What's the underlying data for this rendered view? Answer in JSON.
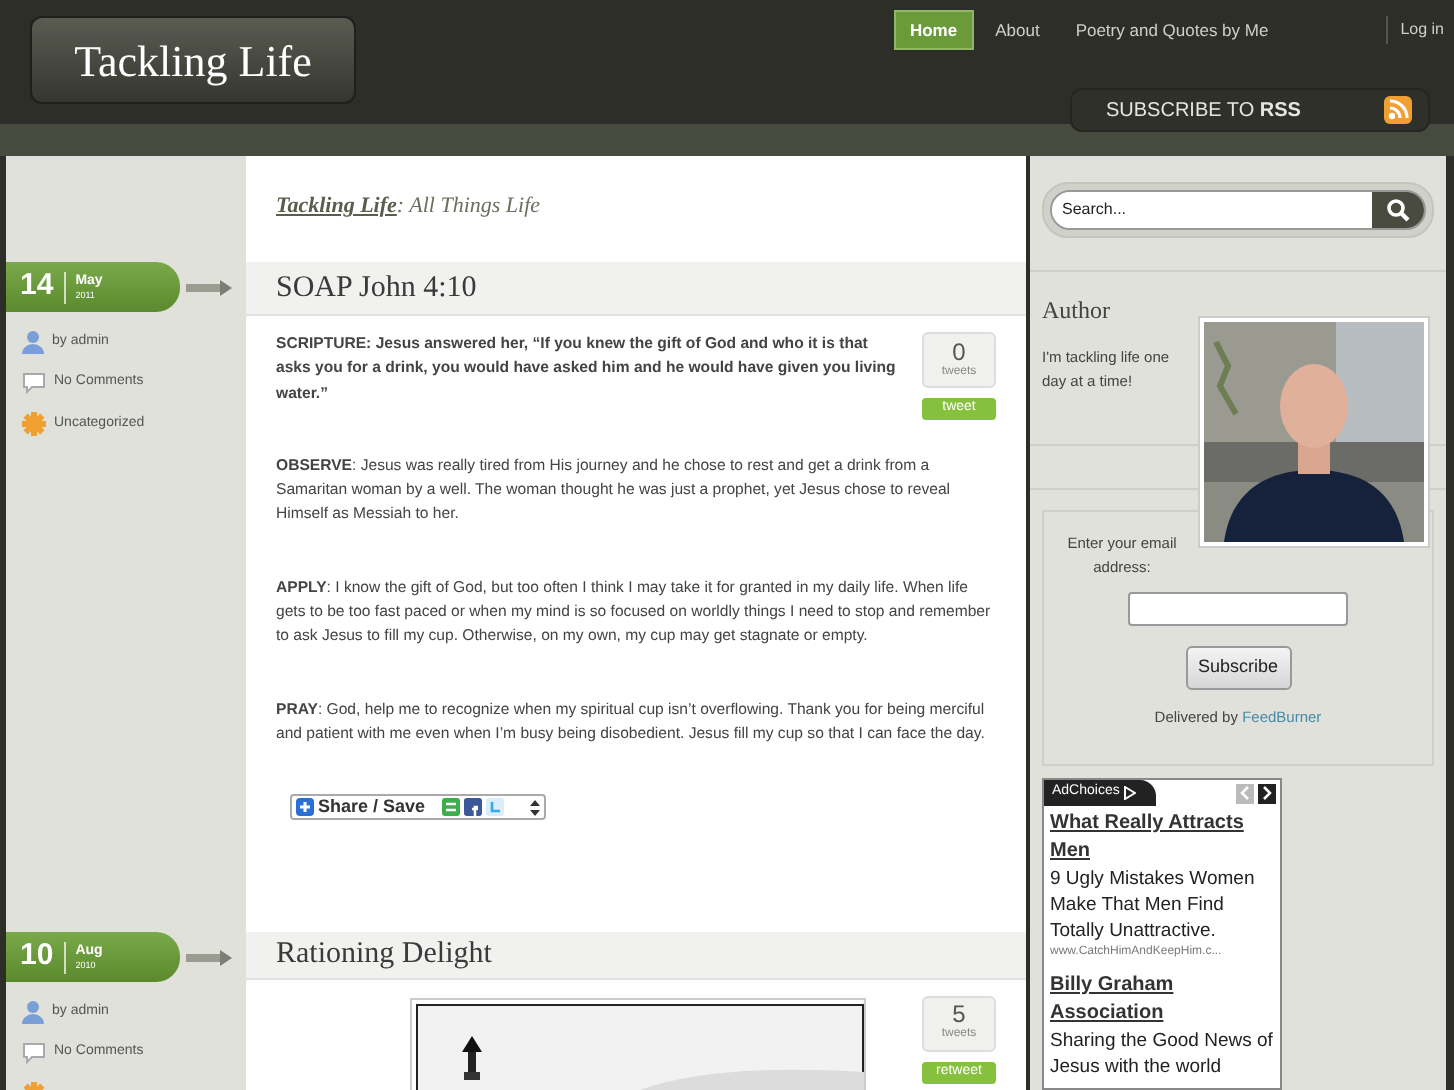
{
  "site": {
    "title": "Tackling Life",
    "tagline_link": "Tackling Life",
    "tagline": ": All Things Life"
  },
  "nav": [
    {
      "label": "Home",
      "selected": true
    },
    {
      "label": "About",
      "selected": false
    },
    {
      "label": "Poetry and Quotes by Me",
      "selected": false
    }
  ],
  "login": "Log in",
  "rss": {
    "text": "SUBSCRIBE TO **RSS**"
  },
  "posts": [
    {
      "day": "14",
      "month": "May",
      "year": "2011",
      "title": "SOAP John 4:10",
      "meta": [
        {
          "kind": "author",
          "label": "by admin"
        },
        {
          "kind": "comments",
          "label": "No Comments"
        },
        {
          "kind": "category",
          "label": "Uncategorized"
        }
      ],
      "tweets": {
        "count": "0",
        "unit": "tweets",
        "button": "tweet"
      },
      "paragraphs": [
        {
          "bold": true,
          "text": "SCRIPTURE: Jesus answered her, “If you knew the gift of God and who it is that asks you for a drink, you would have asked him and he would have given you living water.”"
        },
        {
          "bold": false,
          "text": "**OBSERVE**: Jesus was really tired from His journey and he chose to rest and get a drink from a Samaritan woman by a well. The woman thought he was just a prophet, yet Jesus chose to reveal Himself as Messiah to her."
        },
        {
          "bold": false,
          "text": "**APPLY**: I know the gift of God, but too often I think I may take it for granted in my daily life. When life gets to be too fast paced or when my mind is so focused on worldly things I need to stop and remember to ask Jesus to fill my cup. Otherwise, on my own, my cup may get stagnate or empty."
        },
        {
          "bold": false,
          "text": "**PRAY**: God, help me to recognize when my spiritual cup isn’t overflowing. Thank you for being merciful and patient with me even when I’m busy being disobedient. Jesus fill my cup so that I can face the day."
        }
      ],
      "share": "Share / Save"
    },
    {
      "day": "10",
      "month": "Aug",
      "year": "2010",
      "title": "Rationing Delight",
      "meta": [
        {
          "kind": "author",
          "label": "by admin"
        },
        {
          "kind": "comments",
          "label": "No Comments"
        },
        {
          "kind": "category"
        }
      ],
      "tweets": {
        "count": "5",
        "unit": "tweets",
        "button": "retweet"
      },
      "image": {
        "kind": "picture"
      }
    }
  ],
  "sidebar": {
    "search": {
      "placeholder": "Search..."
    },
    "author": {
      "heading": "Author",
      "text": "I'm tackling life one day at a time!",
      "photo": {
        "kind": "picture"
      }
    },
    "email": {
      "label": "Enter your email address:",
      "button": "Subscribe",
      "delivered": "Delivered by",
      "link": "FeedBurner"
    },
    "ads": {
      "label": "AdChoices",
      "items": [
        {
          "title": "What Really Attracts Men",
          "text": "9 Ugly Mistakes Women Make That Men Find Totally Unattractive.",
          "url": "www.CatchHimAndKeepHim.c..."
        },
        {
          "title": "Billy Graham Association",
          "text": "Sharing the Good News of Jesus with the world"
        }
      ]
    }
  }
}
